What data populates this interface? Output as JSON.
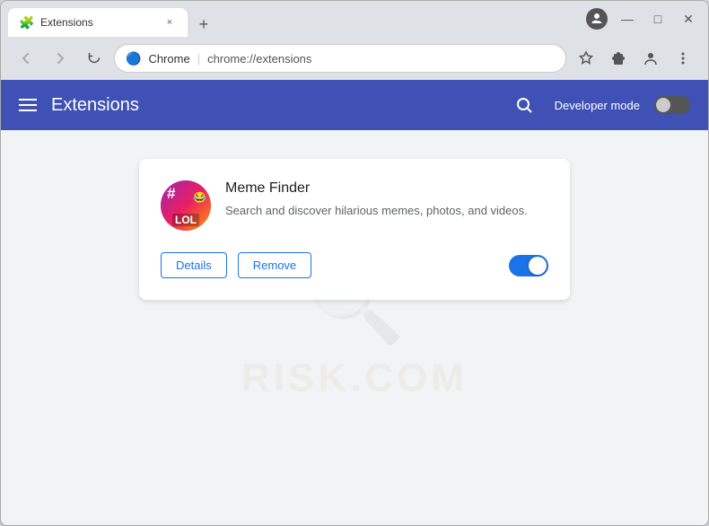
{
  "window": {
    "title": "Extensions",
    "controls": {
      "minimize": "—",
      "maximize": "□",
      "close": "✕"
    }
  },
  "tab": {
    "favicon_alt": "extensions-favicon",
    "title": "Extensions",
    "close_label": "×"
  },
  "toolbar": {
    "back_label": "←",
    "forward_label": "→",
    "reload_label": "↻",
    "address_brand": "Chrome",
    "address_url": "chrome://extensions",
    "star_label": "☆",
    "extensions_label": "🧩",
    "profile_label": "👤",
    "menu_label": "⋮"
  },
  "header": {
    "title": "Extensions",
    "developer_mode_label": "Developer mode",
    "search_alt": "search-icon"
  },
  "extension": {
    "name": "Meme Finder",
    "description": "Search and discover hilarious memes, photos, and videos.",
    "icon_hash": "#",
    "icon_lol": "LOL",
    "details_label": "Details",
    "remove_label": "Remove",
    "enabled": true
  },
  "watermark": {
    "text": "RISK.COM"
  },
  "colors": {
    "header_bg": "#3f51b5",
    "toggle_on": "#1a73e8",
    "btn_border": "#1a73e8"
  }
}
